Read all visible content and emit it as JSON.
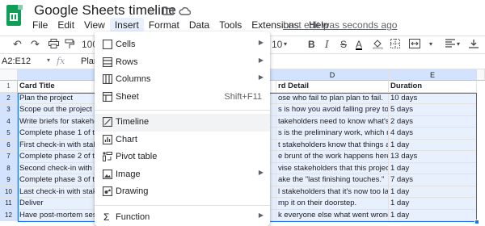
{
  "app": {
    "title": "Google Sheets timeline",
    "last_edit": "Last edit was seconds ago"
  },
  "menu": [
    "File",
    "Edit",
    "View",
    "Insert",
    "Format",
    "Data",
    "Tools",
    "Extensions",
    "Help"
  ],
  "toolbar": {
    "zoom": "100",
    "font_size": "10",
    "bold": "B",
    "italic": "I",
    "strike": "S",
    "text_color": "A"
  },
  "formula_bar": {
    "name_box": "A2:E12",
    "fx": "fx",
    "value": "Plan"
  },
  "grid": {
    "columns": [
      "A",
      "D",
      "E"
    ],
    "rows": [
      "1",
      "2",
      "3",
      "4",
      "5",
      "6",
      "7",
      "8",
      "9",
      "10",
      "11",
      "12"
    ],
    "header": {
      "a": "Card Title",
      "d": "rd Detail",
      "e": "Duration"
    },
    "data": [
      {
        "a": "Plan the project",
        "d": "ose who fail to plan plan to fail.",
        "e": "10 days"
      },
      {
        "a": "Scope out the project",
        "d": "s is how you avoid falling prey to scop",
        "e": "5 days"
      },
      {
        "a": "Write briefs for stakeho",
        "d": "takeholders need to know what's going",
        "e": "2 days"
      },
      {
        "a": "Complete phase 1 of th",
        "d": "s is the preliminary work, which needs",
        "e": "4 days"
      },
      {
        "a": "First check-in with stak",
        "d": "t stakeholders know that things are tr",
        "e": "1 day"
      },
      {
        "a": "Complete phase 2 of th",
        "d": "e brunt of the work happens here, sec",
        "e": "13 days"
      },
      {
        "a": "Second check-in with s",
        "d": "vise stakeholders that this project is a",
        "e": "1 day"
      },
      {
        "a": "Complete phase 3 of th",
        "d": "ake the \"last finishing touches.\"",
        "e": "7 days"
      },
      {
        "a": "Last check-in with stak",
        "d": "l stakeholders that it's now too late to",
        "e": "1 day"
      },
      {
        "a": "Deliver",
        "d": "mp it on their doorstep.",
        "e": "1 day"
      },
      {
        "a": "Have post-mortem sess",
        "d": "k everyone else what went wrong.",
        "e": "1 day"
      }
    ]
  },
  "insert_menu": {
    "items": [
      {
        "label": "Cells",
        "icon": "insert-cells-icon",
        "submenu": true
      },
      {
        "label": "Rows",
        "icon": "insert-rows-icon",
        "submenu": true
      },
      {
        "label": "Columns",
        "icon": "insert-columns-icon",
        "submenu": true
      },
      {
        "label": "Sheet",
        "icon": "insert-sheet-icon",
        "shortcut": "Shift+F11"
      },
      {
        "label": "Timeline",
        "icon": "timeline-icon",
        "highlighted": true
      },
      {
        "label": "Chart",
        "icon": "chart-icon"
      },
      {
        "label": "Pivot table",
        "icon": "pivot-table-icon"
      },
      {
        "label": "Image",
        "icon": "image-icon",
        "submenu": true
      },
      {
        "label": "Drawing",
        "icon": "drawing-icon"
      },
      {
        "label": "Function",
        "icon": "function-icon",
        "submenu": true
      }
    ]
  },
  "colors": {
    "selection_fill": "#e8f0fe",
    "selection_border": "#1a73e8",
    "brand_green": "#0f9d58"
  }
}
